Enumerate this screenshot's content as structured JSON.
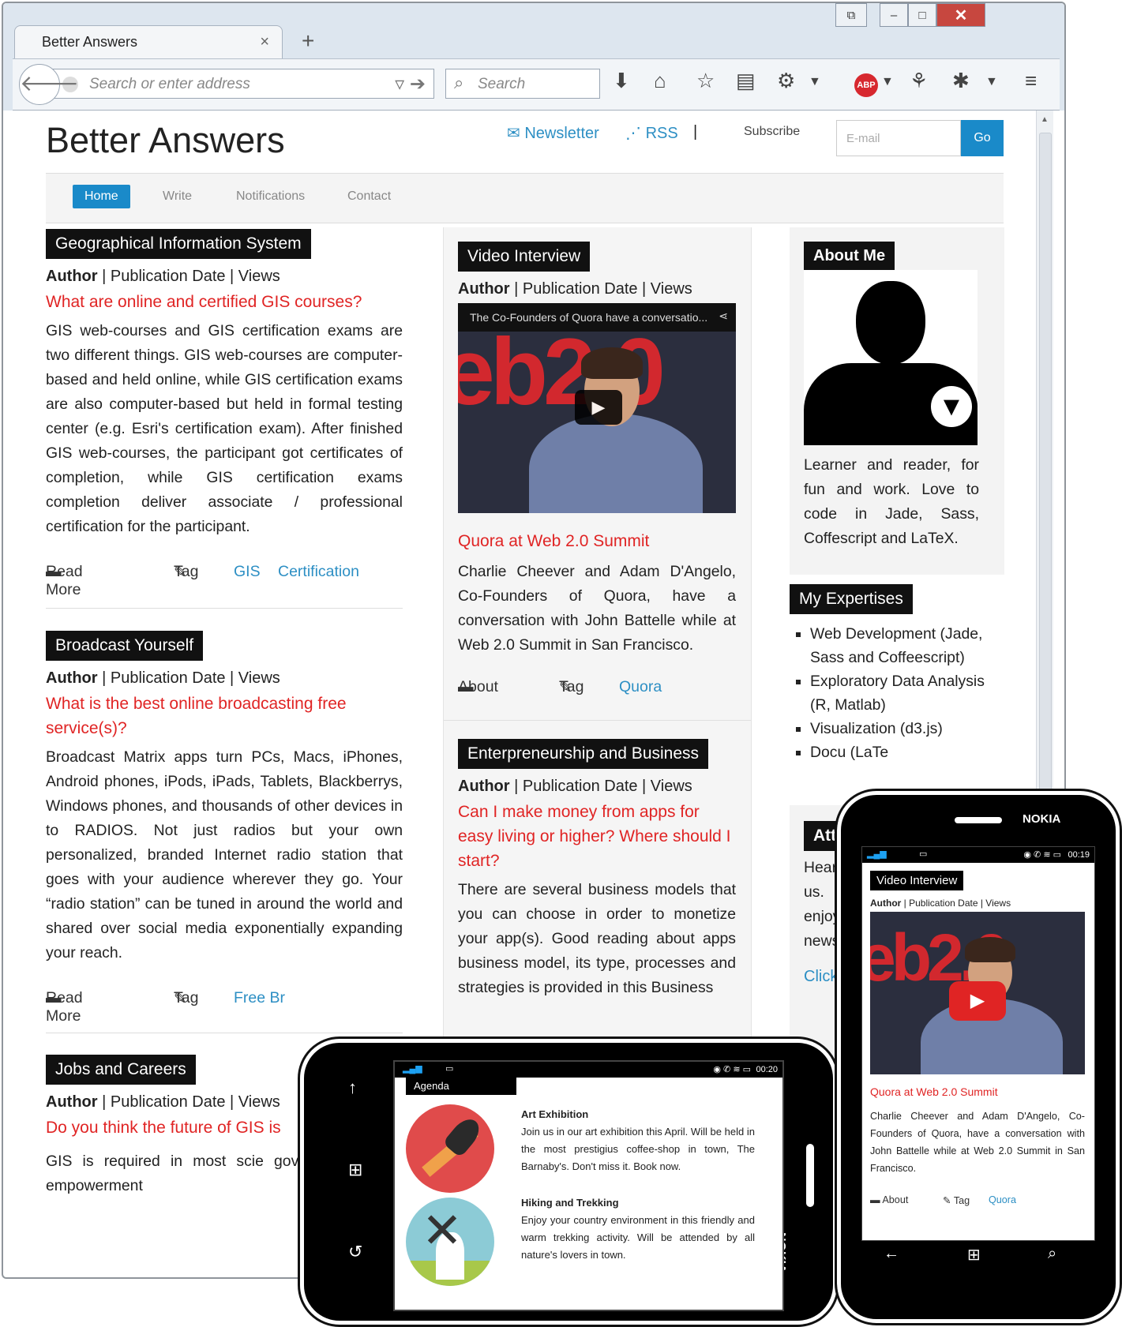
{
  "browser": {
    "tab_title": "Better Answers",
    "tab_close": "×",
    "new_tab": "+",
    "address_placeholder": "Search or enter address",
    "search_placeholder": "Search",
    "window_buttons": [
      "⧉",
      "–",
      "□",
      "✕"
    ]
  },
  "site": {
    "brand": "Better Answers",
    "newsletter": "Newsletter",
    "rss": "RSS",
    "sep": "|",
    "subscribe": "Subscribe",
    "email_placeholder": "E-mail",
    "go": "Go",
    "menu": [
      "Home",
      "Write",
      "Notifications",
      "Contact"
    ]
  },
  "left_posts": [
    {
      "category": "Geographical Information System",
      "meta_author": "Author",
      "meta_rest": " | Publication Date | Views",
      "question": "What are online and certified GIS courses?",
      "body": "GIS web-courses and GIS certification exams are two different things. GIS web-courses are computer-based and held online, while GIS certification exams are also computer-based but held in formal testing center (e.g. Esri's certification exam). After finished GIS web-courses, the participant got certificates of completion, while GIS certification exams completion deliver associate / professional certification for the participant.",
      "read_more": "Read More",
      "tag": "Tag",
      "tags": [
        "GIS",
        "Certification"
      ]
    },
    {
      "category": "Broadcast Yourself",
      "meta_author": "Author",
      "meta_rest": " | Publication Date | Views",
      "question": "What is the best online broadcasting free service(s)?",
      "body": "Broadcast Matrix apps turn PCs, Macs, iPhones, Android phones, iPods, iPads, Tablets, Blackberrys, Windows phones, and thousands of other devices in to RADIOS. Not just radios but your own personalized, branded Internet radio station that goes with your audience wherever they go. Your “radio station” can be tuned in around the world and shared over social media exponentially expanding your reach.",
      "read_more": "Read More",
      "tag": "Tag",
      "tags": [
        "Free Br"
      ]
    },
    {
      "category": "Jobs and Careers",
      "meta_author": "Author",
      "meta_rest": " | Publication Date | Views",
      "question": "Do you think the future of GIS is",
      "body": "GIS is required in most scie governmental and empowerment"
    }
  ],
  "mid_posts": [
    {
      "category": "Video Interview",
      "meta_author": "Author",
      "meta_rest": " | Publication Date | Views",
      "video_title": "The Co-Founders of Quora have a conversatio...",
      "video_bg_text": "eb2.0",
      "title": "Quora at Web 2.0 Summit",
      "body": "Charlie Cheever and Adam D'Angelo, Co-Founders of Quora, have a conversation with John Battelle while at Web 2.0 Summit in San Francisco.",
      "about": "About",
      "tag": "Tag",
      "tags": [
        "Quora"
      ]
    },
    {
      "category": "Enterpreneurship and Business",
      "meta_author": "Author",
      "meta_rest": " | Publication Date | Views",
      "question": "Can I make money from apps for easy living or higher? Where should I start?",
      "body": "There are several business models that you can choose in order to monetize your app(s). Good reading about apps business model, its type, processes and strategies is provided in this Business"
    }
  ],
  "right": {
    "about_title": "About Me",
    "about_text": "Learner and reader, for fun and work. Love to code in Jade, Sass, Coffescript and LaTeX.",
    "expertise_title": "My Expertises",
    "expertises": [
      "Web Development (Jade, Sass and Coffeescript)",
      "Exploratory Data Analysis (R, Matlab)",
      "Visualization (d3.js)",
      "Docu (LaTe"
    ],
    "partial_title": "Atte",
    "partial_lines": [
      "Hear",
      "us.",
      "enjoy",
      "news"
    ],
    "partial_link": "Click"
  },
  "phone_landscape": {
    "time": "00:20",
    "agenda": "Agenda",
    "brand": "NOKIA",
    "items": [
      {
        "title": "Art Exhibition",
        "text": "Join us in our art exhibition this April. Will be held in the most prestigius coffee-shop in town, The Barnaby's. Don't miss it. Book now."
      },
      {
        "title": "Hiking and Trekking",
        "text": "Enjoy your country environment in this friendly and warm trekking activity. Will be attended by all nature's lovers in town."
      }
    ]
  },
  "phone_portrait": {
    "brand": "NOKIA",
    "time": "00:19",
    "category": "Video Interview",
    "meta_author": "Author",
    "meta_rest": " | Publication Date | Views",
    "video_bg_text": "eb2.0",
    "title": "Quora at Web 2.0 Summit",
    "body": "Charlie Cheever and Adam D'Angelo, Co-Founders of Quora, have a conversation with John Battelle while at Web 2.0 Summit in San Francisco.",
    "about": "About",
    "tag": "Tag",
    "tag_value": "Quora"
  }
}
